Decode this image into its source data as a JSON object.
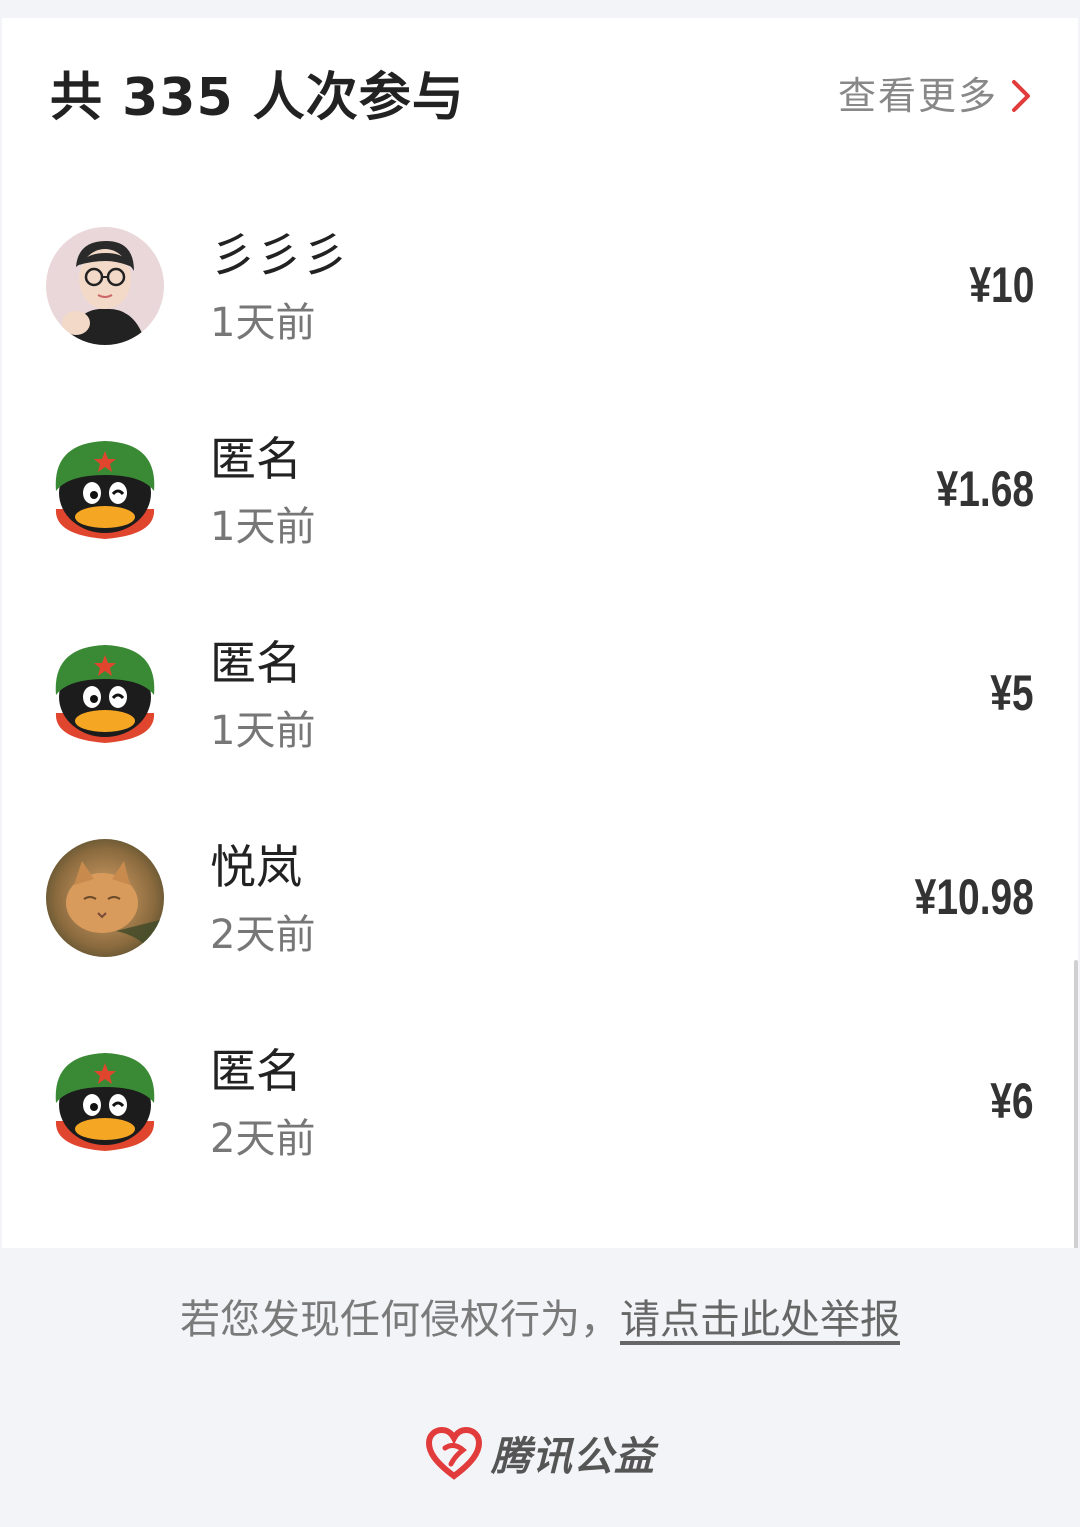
{
  "header": {
    "title": "共 335 人次参与",
    "more_label": "查看更多"
  },
  "donors": [
    {
      "name": "彡彡彡",
      "time": "1天前",
      "amount": "¥10",
      "avatar": "boy-glasses-photo"
    },
    {
      "name": "匿名",
      "time": "1天前",
      "amount": "¥1.68",
      "avatar": "qq-penguin-avatar"
    },
    {
      "name": "匿名",
      "time": "1天前",
      "amount": "¥5",
      "avatar": "qq-penguin-avatar"
    },
    {
      "name": "悦岚",
      "time": "2天前",
      "amount": "¥10.98",
      "avatar": "cat-photo"
    },
    {
      "name": "匿名",
      "time": "2天前",
      "amount": "¥6",
      "avatar": "qq-penguin-avatar"
    }
  ],
  "footer": {
    "report_text": "若您发现任何侵权行为，",
    "report_link": "请点击此处举报",
    "brand_name": "腾讯公益"
  },
  "colors": {
    "accent_red": "#e23b3b",
    "background": "#f3f4f8",
    "penguin_hat_green": "#3a8a35",
    "penguin_scarf_red": "#e0462e",
    "penguin_beak": "#f5a623"
  }
}
